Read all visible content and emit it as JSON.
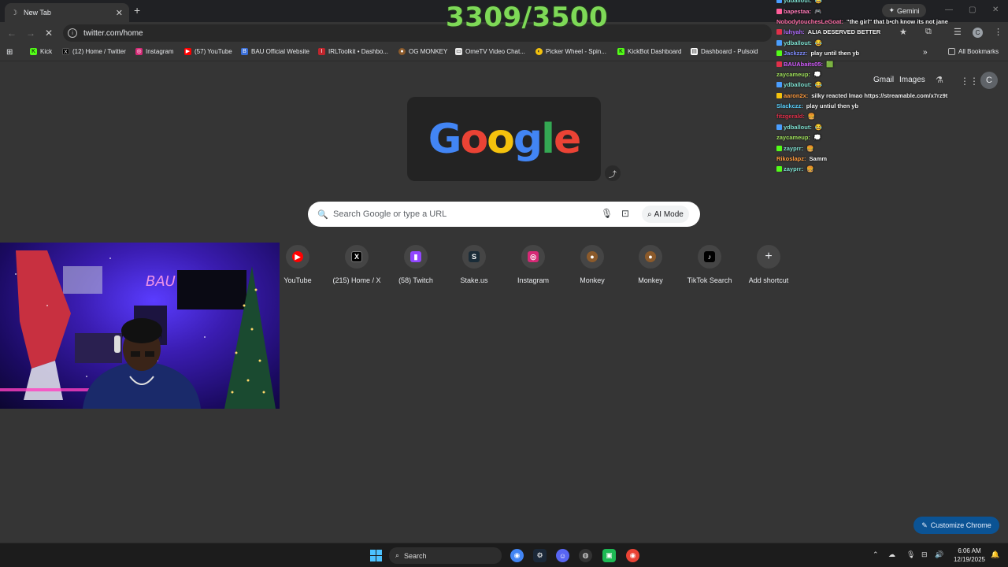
{
  "browser": {
    "tab": {
      "title": "New Tab"
    },
    "url": "twitter.com/home",
    "gemini_label": "Gemini",
    "bookmarks": [
      {
        "label": "Kick",
        "color": "#53fc18",
        "glyph": "K"
      },
      {
        "label": "(12) Home / Twitter",
        "color": "#000000",
        "glyph": "X"
      },
      {
        "label": "Instagram",
        "color": "#d62976",
        "glyph": "◎"
      },
      {
        "label": "(57) YouTube",
        "color": "#ff0000",
        "glyph": "▶"
      },
      {
        "label": "BAU Official Website",
        "color": "#3b6fd8",
        "glyph": "B"
      },
      {
        "label": "IRLToolkit • Dashbo...",
        "color": "#c0262d",
        "glyph": "I"
      },
      {
        "label": "OG MONKEY",
        "color": "#8b5a2b",
        "glyph": "●"
      },
      {
        "label": "OmeTV Video Chat...",
        "color": "#e8e8e8",
        "glyph": "▭"
      },
      {
        "label": "Picker Wheel - Spin...",
        "color": "#f4c20d",
        "glyph": "◐"
      },
      {
        "label": "KickBot Dashboard",
        "color": "#53fc18",
        "glyph": "K"
      },
      {
        "label": "Dashboard - Pulsoid",
        "color": "#ffffff",
        "glyph": "▤"
      },
      {
        "label": "All Bookmarks",
        "color": "#9aa0a6",
        "glyph": "▭"
      }
    ]
  },
  "overlay": {
    "counter": "3309/3500",
    "chat": [
      {
        "user": "ydballout:",
        "user_color": "#7ee0d0",
        "msg": "😂",
        "badge": "#4a9eff"
      },
      {
        "user": "bapestaa:",
        "user_color": "#ff7ab8",
        "msg": "🎮",
        "badge": "#ff5e9a"
      },
      {
        "user": "NobodytouchesLeGoat:",
        "user_color": "#ff6fa8",
        "msg": "\"the girl\" that b•ch know its not jane",
        "badge": ""
      },
      {
        "user": "luhyah:",
        "user_color": "#b06bff",
        "msg": "ALIA DESERVED BETTER",
        "badge": "#e0304a"
      },
      {
        "user": "ydballout:",
        "user_color": "#7ee0d0",
        "msg": "😂",
        "badge": "#4a9eff"
      },
      {
        "user": "Jackzzz:",
        "user_color": "#7e8cff",
        "msg": "play until then yb",
        "badge": "#53fc18"
      },
      {
        "user": "BAUAbaits05:",
        "user_color": "#d35bff",
        "msg": "🟩",
        "badge": "#e0304a"
      },
      {
        "user": "zaycameup:",
        "user_color": "#9fe05b",
        "msg": "💭",
        "badge": ""
      },
      {
        "user": "ydballout:",
        "user_color": "#7ee0d0",
        "msg": "😂",
        "badge": "#4a9eff"
      },
      {
        "user": "aaron2x:",
        "user_color": "#ff9a3c",
        "msg": "silky reacted lmao https://streamable.com/x7rz9t",
        "badge": "#f4c20d"
      },
      {
        "user": "Slackczz:",
        "user_color": "#5bd3ff",
        "msg": "play untiul then yb",
        "badge": ""
      },
      {
        "user": "fitzgerald:",
        "user_color": "#e0304a",
        "msg": "🍔",
        "badge": ""
      },
      {
        "user": "ydballout:",
        "user_color": "#7ee0d0",
        "msg": "😂",
        "badge": "#4a9eff"
      },
      {
        "user": "zaycameup:",
        "user_color": "#9fe05b",
        "msg": "💭",
        "badge": ""
      },
      {
        "user": "zayprr:",
        "user_color": "#7ee0d0",
        "msg": "🍔",
        "badge": "#53fc18"
      },
      {
        "user": "Rikoslapz:",
        "user_color": "#ff9a3c",
        "msg": "Samm",
        "badge": ""
      },
      {
        "user": "zayprr:",
        "user_color": "#7ee0d0",
        "msg": "🍔",
        "badge": "#53fc18"
      }
    ]
  },
  "google": {
    "gmail": "Gmail",
    "images": "Images",
    "avatar_letter": "C",
    "search_placeholder": "Search Google or type a URL",
    "ai_mode": "AI Mode",
    "shortcuts": [
      {
        "label": "YouTube",
        "glyph": "▶",
        "color": "#ff0000"
      },
      {
        "label": "(215) Home / X",
        "glyph": "X",
        "color": "#000000"
      },
      {
        "label": "(58) Twitch",
        "glyph": "▮",
        "color": "#9146ff"
      },
      {
        "label": "Stake.us",
        "glyph": "S",
        "color": "#1a2c38"
      },
      {
        "label": "Instagram",
        "glyph": "◎",
        "color": "#d62976"
      },
      {
        "label": "Monkey",
        "glyph": "🐵",
        "color": "#8b5a2b"
      },
      {
        "label": "Monkey",
        "glyph": "🐵",
        "color": "#8b5a2b"
      },
      {
        "label": "TikTok Search",
        "glyph": "♪",
        "color": "#000000"
      },
      {
        "label": "Add shortcut",
        "glyph": "+",
        "color": "transparent"
      }
    ],
    "customize": "Customize Chrome"
  },
  "taskbar": {
    "search": "Search",
    "time": "6:06 AM",
    "date": "12/19/2025"
  }
}
